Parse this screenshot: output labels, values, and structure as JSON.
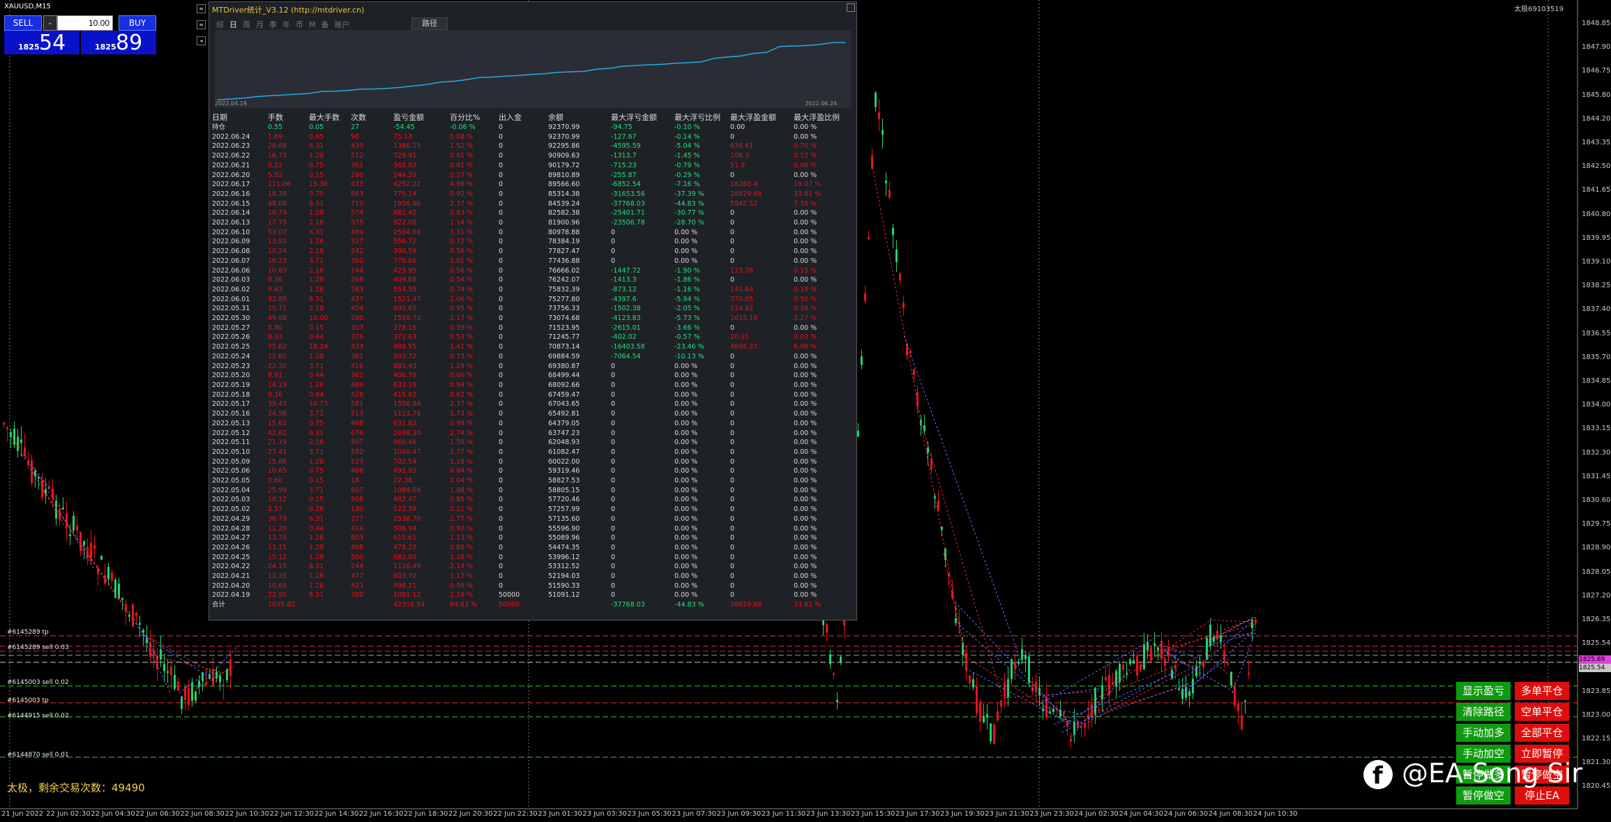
{
  "symbol": "XAUUSD,M15",
  "account_label": "太极69103519",
  "trade": {
    "sell": "SELL",
    "buy": "BUY",
    "lot": "10.00",
    "dd": "⌄",
    "bid_small": "1825",
    "bid_big": "54",
    "ask_small": "1825",
    "ask_big": "89"
  },
  "panel": {
    "title": "MTDriver统计_V3.12 (http://mtdriver.cn)",
    "tabs": [
      "综",
      "日",
      "周",
      "月",
      "季",
      "年",
      "币",
      "M",
      "备",
      "账户"
    ],
    "path_button": "路径",
    "date_start": "2022.04.19",
    "date_end": "2022.06.24",
    "headers": [
      "日期",
      "手数",
      "最大手数",
      "次数",
      "盈亏金额",
      "百分比%",
      "出入金",
      "余额",
      "最大浮亏金额",
      "最大浮亏比例",
      "最大浮盈金额",
      "最大浮盈比例"
    ],
    "rows": [
      [
        "持仓",
        "0.55",
        "0.05",
        "27",
        "-54.45",
        "-0.06 %",
        "0",
        "92370.99",
        "-94.75",
        "-0.10 %",
        "0.00",
        "0.00 %"
      ],
      [
        "2022.06.24",
        "1.69",
        "0.05",
        "96",
        "75.13",
        "0.08 %",
        "0",
        "92370.99",
        "-127.67",
        "-0.14 %",
        "0",
        "0.00 %"
      ],
      [
        "2022.06.23",
        "28.68",
        "6.31",
        "439",
        "1386.23",
        "1.52 %",
        "0",
        "92295.86",
        "-4595.59",
        "-5.04 %",
        "636.61",
        "0.70 %"
      ],
      [
        "2022.06.22",
        "16.73",
        "1.28",
        "512",
        "729.91",
        "0.81 %",
        "0",
        "90909.63",
        "-1313.7",
        "-1.45 %",
        "106.3",
        "0.12 %"
      ],
      [
        "2022.06.21",
        "8.22",
        "0.75",
        "361",
        "368.83",
        "0.41 %",
        "0",
        "90179.72",
        "-715.23",
        "-0.79 %",
        "51.9",
        "0.06 %"
      ],
      [
        "2022.06.20",
        "5.52",
        "0.15",
        "290",
        "244.29",
        "0.27 %",
        "0",
        "89810.89",
        "-255.87",
        "-0.29 %",
        "0",
        "0.00 %"
      ],
      [
        "2022.06.17",
        "111.06",
        "15.36",
        "433",
        "4252.22",
        "4.98 %",
        "0",
        "89566.60",
        "-6852.54",
        "-7.16 %",
        "16268.4",
        "19.07 %"
      ],
      [
        "2022.06.16",
        "18.38",
        "0.75",
        "863",
        "775.14",
        "0.92 %",
        "0",
        "85314.38",
        "-31653.56",
        "-37.39 %",
        "28829.68",
        "33.81 %"
      ],
      [
        "2022.06.15",
        "48.08",
        "6.31",
        "719",
        "1956.86",
        "2.37 %",
        "0",
        "84539.24",
        "-37768.03",
        "-44.83 %",
        "5842.52",
        "7.16 %"
      ],
      [
        "2022.06.14",
        "16.79",
        "1.28",
        "574",
        "681.42",
        "0.83 %",
        "0",
        "82582.38",
        "-25401.71",
        "-30.77 %",
        "0",
        "0.00 %"
      ],
      [
        "2022.06.13",
        "17.75",
        "2.18",
        "575",
        "922.08",
        "1.14 %",
        "0",
        "81900.96",
        "-23506.78",
        "-28.70 %",
        "0",
        "0.00 %"
      ],
      [
        "2022.06.10",
        "53.07",
        "6.31",
        "489",
        "2594.69",
        "3.31 %",
        "0",
        "80978.88",
        "0",
        "0.00 %",
        "0",
        "0.00 %"
      ],
      [
        "2022.06.09",
        "13.92",
        "1.28",
        "327",
        "556.72",
        "0.72 %",
        "0",
        "78384.19",
        "0",
        "0.00 %",
        "0",
        "0.00 %"
      ],
      [
        "2022.06.08",
        "10.24",
        "2.18",
        "242",
        "390.59",
        "0.56 %",
        "0",
        "77827.47",
        "0",
        "0.00 %",
        "0",
        "0.00 %"
      ],
      [
        "2022.06.07",
        "16.23",
        "3.71",
        "360",
        "770.66",
        "1.01 %",
        "0",
        "77436.88",
        "0",
        "0.00 %",
        "0",
        "0.00 %"
      ],
      [
        "2022.06.06",
        "10.83",
        "2.18",
        "244",
        "423.95",
        "0.56 %",
        "0",
        "76666.02",
        "-1447.72",
        "-1.90 %",
        "113.76",
        "0.15 %"
      ],
      [
        "2022.06.03",
        "8.36",
        "1.28",
        "268",
        "409.68",
        "0.54 %",
        "0",
        "76242.07",
        "-1413.3",
        "-1.86 %",
        "0",
        "0.00 %"
      ],
      [
        "2022.06.02",
        "9.43",
        "1.28",
        "283",
        "554.59",
        "0.74 %",
        "0",
        "75832.39",
        "-873.12",
        "-1.16 %",
        "141.64",
        "0.19 %"
      ],
      [
        "2022.06.01",
        "32.89",
        "6.31",
        "437",
        "1521.47",
        "2.06 %",
        "0",
        "75277.80",
        "-4397.6",
        "-5.94 %",
        "370.05",
        "0.50 %"
      ],
      [
        "2022.05.31",
        "15.71",
        "2.18",
        "454",
        "691.65",
        "0.95 %",
        "0",
        "73756.33",
        "-1502.38",
        "-2.05 %",
        "114.82",
        "0.16 %"
      ],
      [
        "2022.05.30",
        "49.68",
        "10.00",
        "280",
        "1550.73",
        "2.17 %",
        "0",
        "73074.68",
        "-4123.83",
        "-5.73 %",
        "1615.19",
        "2.27 %"
      ],
      [
        "2022.05.27",
        "5.80",
        "0.15",
        "303",
        "278.18",
        "0.39 %",
        "0",
        "71523.95",
        "-2615.01",
        "-3.66 %",
        "0",
        "0.00 %"
      ],
      [
        "2022.05.26",
        "8.33",
        "0.44",
        "376",
        "372.63",
        "0.53 %",
        "0",
        "71245.77",
        "-402.02",
        "-0.57 %",
        "20.91",
        "0.03 %"
      ],
      [
        "2022.05.25",
        "75.62",
        "18.24",
        "433",
        "988.55",
        "1.41 %",
        "0",
        "70873.14",
        "-16403.58",
        "-23.46 %",
        "4886.27",
        "6.98 %"
      ],
      [
        "2022.05.24",
        "11.85",
        "1.28",
        "381",
        "503.72",
        "0.73 %",
        "0",
        "69884.59",
        "-7064.54",
        "-10.13 %",
        "0",
        "0.00 %"
      ],
      [
        "2022.05.23",
        "22.30",
        "3.71",
        "416",
        "881.43",
        "1.29 %",
        "0",
        "69380.87",
        "0",
        "0.00 %",
        "0",
        "0.00 %"
      ],
      [
        "2022.05.20",
        "8.91",
        "0.44",
        "362",
        "406.78",
        "0.60 %",
        "0",
        "68499.44",
        "0",
        "0.00 %",
        "0",
        "0.00 %"
      ],
      [
        "2022.05.19",
        "14.19",
        "1.28",
        "489",
        "633.19",
        "0.94 %",
        "0",
        "68092.66",
        "0",
        "0.00 %",
        "0",
        "0.00 %"
      ],
      [
        "2022.05.18",
        "9.16",
        "0.44",
        "428",
        "415.82",
        "0.62 %",
        "0",
        "67459.47",
        "0",
        "0.00 %",
        "0",
        "0.00 %"
      ],
      [
        "2022.05.17",
        "38.43",
        "10.73",
        "581",
        "1556.84",
        "2.37 %",
        "0",
        "67043.65",
        "0",
        "0.00 %",
        "0",
        "0.00 %"
      ],
      [
        "2022.05.16",
        "24.56",
        "3.71",
        "513",
        "1113.76",
        "1.73 %",
        "0",
        "65492.81",
        "0",
        "0.00 %",
        "0",
        "0.00 %"
      ],
      [
        "2022.05.13",
        "15.62",
        "0.75",
        "468",
        "631.82",
        "0.99 %",
        "0",
        "64379.05",
        "0",
        "0.00 %",
        "0",
        "0.00 %"
      ],
      [
        "2022.05.12",
        "42.62",
        "6.31",
        "676",
        "1698.30",
        "2.74 %",
        "0",
        "63747.23",
        "0",
        "0.00 %",
        "0",
        "0.00 %"
      ],
      [
        "2022.05.11",
        "21.19",
        "2.18",
        "507",
        "966.46",
        "1.58 %",
        "0",
        "62048.93",
        "0",
        "0.00 %",
        "0",
        "0.00 %"
      ],
      [
        "2022.05.10",
        "27.41",
        "3.71",
        "552",
        "1060.47",
        "1.77 %",
        "0",
        "61082.47",
        "0",
        "0.00 %",
        "0",
        "0.00 %"
      ],
      [
        "2022.05.09",
        "15.86",
        "1.28",
        "523",
        "702.54",
        "1.18 %",
        "0",
        "60022.00",
        "0",
        "0.00 %",
        "0",
        "0.00 %"
      ],
      [
        "2022.05.06",
        "10.65",
        "0.75",
        "486",
        "491.93",
        "0.84 %",
        "0",
        "59319.46",
        "0",
        "0.00 %",
        "0",
        "0.00 %"
      ],
      [
        "2022.05.05",
        "0.60",
        "0.15",
        "18",
        "22.38",
        "0.04 %",
        "0",
        "58827.53",
        "0",
        "0.00 %",
        "0",
        "0.00 %"
      ],
      [
        "2022.05.04",
        "25.99",
        "3.71",
        "607",
        "1084.69",
        "1.88 %",
        "0",
        "58805.15",
        "0",
        "0.00 %",
        "0",
        "0.00 %"
      ],
      [
        "2022.05.03",
        "10.12",
        "0.15",
        "506",
        "482.47",
        "0.85 %",
        "0",
        "57720.46",
        "0",
        "0.00 %",
        "0",
        "0.00 %"
      ],
      [
        "2022.05.02",
        "2.57",
        "0.26",
        "130",
        "122.39",
        "0.21 %",
        "0",
        "57257.99",
        "0",
        "0.00 %",
        "0",
        "0.00 %"
      ],
      [
        "2022.04.29",
        "36.79",
        "6.31",
        "277",
        "1538.70",
        "2.77 %",
        "0",
        "57135.60",
        "0",
        "0.00 %",
        "0",
        "0.00 %"
      ],
      [
        "2022.04.28",
        "11.20",
        "0.44",
        "414",
        "506.94",
        "0.92 %",
        "0",
        "55596.90",
        "0",
        "0.00 %",
        "0",
        "0.00 %"
      ],
      [
        "2022.04.27",
        "13.76",
        "1.28",
        "603",
        "615.61",
        "1.13 %",
        "0",
        "55089.96",
        "0",
        "0.00 %",
        "0",
        "0.00 %"
      ],
      [
        "2022.04.26",
        "11.15",
        "1.28",
        "408",
        "478.23",
        "0.89 %",
        "0",
        "54474.35",
        "0",
        "0.00 %",
        "0",
        "0.00 %"
      ],
      [
        "2022.04.25",
        "15.12",
        "1.28",
        "550",
        "683.60",
        "1.28 %",
        "0",
        "53996.12",
        "0",
        "0.00 %",
        "0",
        "0.00 %"
      ],
      [
        "2022.04.22",
        "24.15",
        "6.31",
        "244",
        "1116.49",
        "2.14 %",
        "0",
        "53312.52",
        "0",
        "0.00 %",
        "0",
        "0.00 %"
      ],
      [
        "2022.04.21",
        "13.35",
        "1.28",
        "477",
        "603.70",
        "1.17 %",
        "0",
        "52194.03",
        "0",
        "0.00 %",
        "0",
        "0.00 %"
      ],
      [
        "2022.04.20",
        "10.69",
        "1.28",
        "423",
        "498.21",
        "0.98 %",
        "0",
        "51590.33",
        "0",
        "0.00 %",
        "0",
        "0.00 %"
      ],
      [
        "2022.04.19",
        "22.95",
        "6.31",
        "380",
        "1091.12",
        "2.19 %",
        "50000",
        "51091.12",
        "0",
        "0.00 %",
        "0",
        "0.00 %"
      ],
      [
        "合计",
        "1035.82",
        "",
        "",
        "42316.54",
        "84.63 %",
        "50000",
        "",
        "-37768.03",
        "-44.83 %",
        "28829.68",
        "33.81 %"
      ]
    ]
  },
  "orders": [
    {
      "label": "#6145289 tp",
      "color": "#ff4040"
    },
    {
      "label": "#6145289 sell 0.03",
      "color": "#ff4040"
    },
    {
      "label": "#6145003 sell 0.02",
      "color": "#ff4040"
    },
    {
      "label": "#6145003 tp",
      "color": "#ff4040"
    },
    {
      "label": "#6144915 sell 0.02",
      "color": "#ff4040"
    },
    {
      "label": "#6144870 sell 0.01",
      "color": "#ff4040"
    }
  ],
  "price_axis": [
    "1848.85",
    "1847.90",
    "1846.75",
    "1845.80",
    "1844.20",
    "1843.35",
    "1842.50",
    "1841.65",
    "1840.80",
    "1839.95",
    "1839.10",
    "1838.25",
    "1837.40",
    "1836.55",
    "1835.70",
    "1834.85",
    "1834.00",
    "1833.15",
    "1832.30",
    "1831.45",
    "1830.60",
    "1829.75",
    "1828.90",
    "1828.05",
    "1827.20",
    "1826.35",
    "1825.54",
    "1824.70",
    "1823.85",
    "1823.00",
    "1822.15",
    "1821.30",
    "1820.45"
  ],
  "price_tags": {
    "current": "1825.54",
    "marker": "1825.89"
  },
  "time_axis": [
    "21 Jun 2022",
    "22 Jun 02:30",
    "22 Jun 04:30",
    "22 Jun 06:30",
    "22 Jun 08:30",
    "22 Jun 10:30",
    "22 Jun 12:30",
    "22 Jun 14:30",
    "22 Jun 16:30",
    "22 Jun 18:30",
    "22 Jun 20:30",
    "22 Jun 22:30",
    "23 Jun 01:30",
    "23 Jun 03:30",
    "23 Jun 05:30",
    "23 Jun 07:30",
    "23 Jun 09:30",
    "23 Jun 11:30",
    "23 Jun 13:30",
    "23 Jun 15:30",
    "23 Jun 17:30",
    "23 Jun 19:30",
    "23 Jun 21:30",
    "23 Jun 23:30",
    "24 Jun 02:30",
    "24 Jun 04:30",
    "24 Jun 06:30",
    "24 Jun 08:30",
    "24 Jun 10:30"
  ],
  "ea_buttons": [
    {
      "label": "显示盈亏",
      "color": "green"
    },
    {
      "label": "多单平仓",
      "color": "red"
    },
    {
      "label": "清除路径",
      "color": "green"
    },
    {
      "label": "空单平仓",
      "color": "red"
    },
    {
      "label": "手动加多",
      "color": "green"
    },
    {
      "label": "全部平仓",
      "color": "red"
    },
    {
      "label": "手动加空",
      "color": "green"
    },
    {
      "label": "立即暂停",
      "color": "red"
    },
    {
      "label": "暂停做多",
      "color": "green"
    },
    {
      "label": "暂停做空",
      "color": "red"
    },
    {
      "label": "暂停做空",
      "color": "green"
    },
    {
      "label": "停止EA",
      "color": "red"
    }
  ],
  "bottom_note": "太极，剩余交易次数：49490",
  "watermark": "@EA-Song Sir",
  "colors": {
    "up": "#22d36e",
    "down": "#e8121a",
    "accent": "#1a2ee0"
  }
}
